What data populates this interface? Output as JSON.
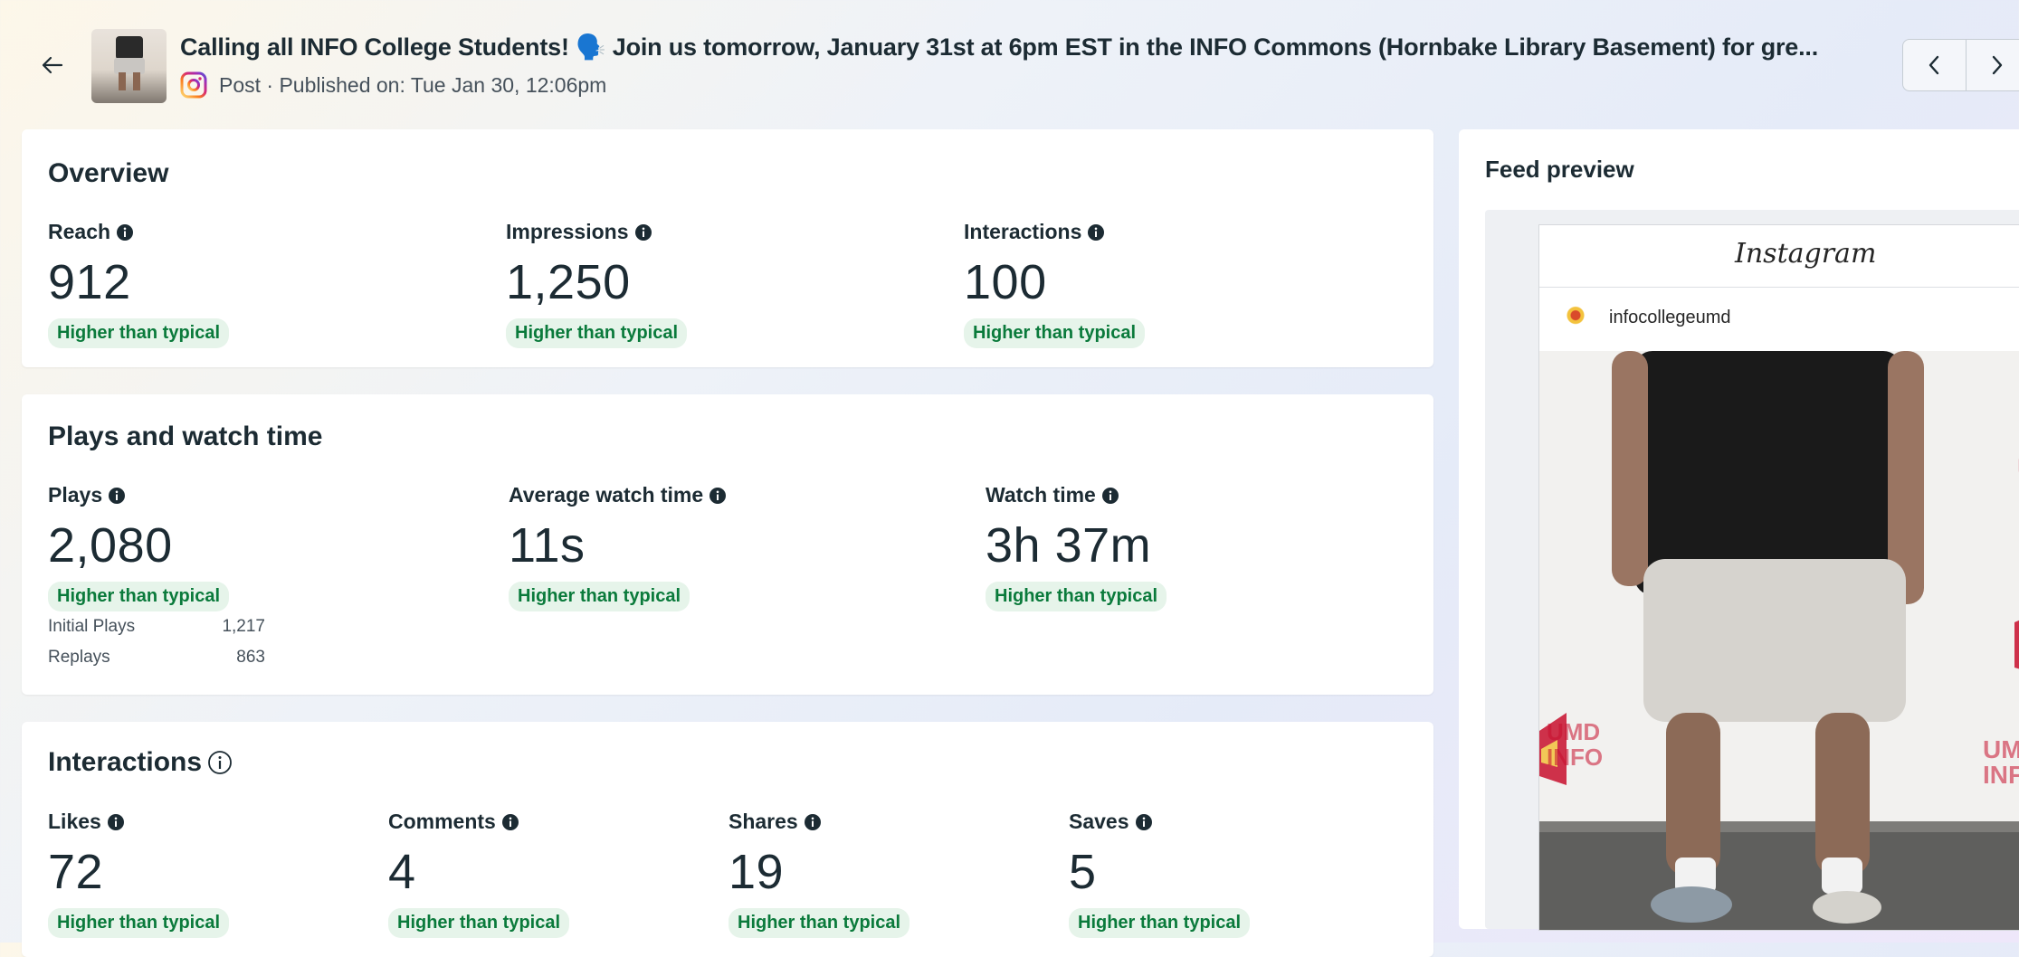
{
  "header": {
    "title": "Calling all INFO College Students! 🗣️ Join us tomorrow, January 31st at 6pm EST in the INFO Commons (Hornbake Library Basement) for gre...",
    "meta": "Post · Published on: Tue Jan 30, 12:06pm",
    "icons": {
      "back": "back-arrow-icon",
      "platform": "instagram-icon",
      "prev": "chevron-left-icon",
      "next": "chevron-right-icon"
    }
  },
  "overview": {
    "title": "Overview",
    "metrics": [
      {
        "label": "Reach",
        "value": "912",
        "badge": "Higher than typical"
      },
      {
        "label": "Impressions",
        "value": "1,250",
        "badge": "Higher than typical"
      },
      {
        "label": "Interactions",
        "value": "100",
        "badge": "Higher than typical"
      }
    ]
  },
  "plays": {
    "title": "Plays and watch time",
    "metrics": [
      {
        "label": "Plays",
        "value": "2,080",
        "badge": "Higher than typical"
      },
      {
        "label": "Average watch time",
        "value": "11s",
        "badge": "Higher than typical"
      },
      {
        "label": "Watch time",
        "value": "3h 37m",
        "badge": "Higher than typical"
      }
    ],
    "breakdown": [
      {
        "label": "Initial Plays",
        "value": "1,217"
      },
      {
        "label": "Replays",
        "value": "863"
      }
    ]
  },
  "interactions": {
    "title": "Interactions",
    "metrics": [
      {
        "label": "Likes",
        "value": "72",
        "badge": "Higher than typical"
      },
      {
        "label": "Comments",
        "value": "4",
        "badge": "Higher than typical"
      },
      {
        "label": "Shares",
        "value": "19",
        "badge": "Higher than typical"
      },
      {
        "label": "Saves",
        "value": "5",
        "badge": "Higher than typical"
      }
    ]
  },
  "feed_preview": {
    "title": "Feed preview",
    "platform_wordmark": "Instagram",
    "username": "infocollegeumd"
  },
  "colors": {
    "badge_bg": "#e6f4ea",
    "badge_text": "#0a7a3b",
    "text": "#1c2b33"
  }
}
